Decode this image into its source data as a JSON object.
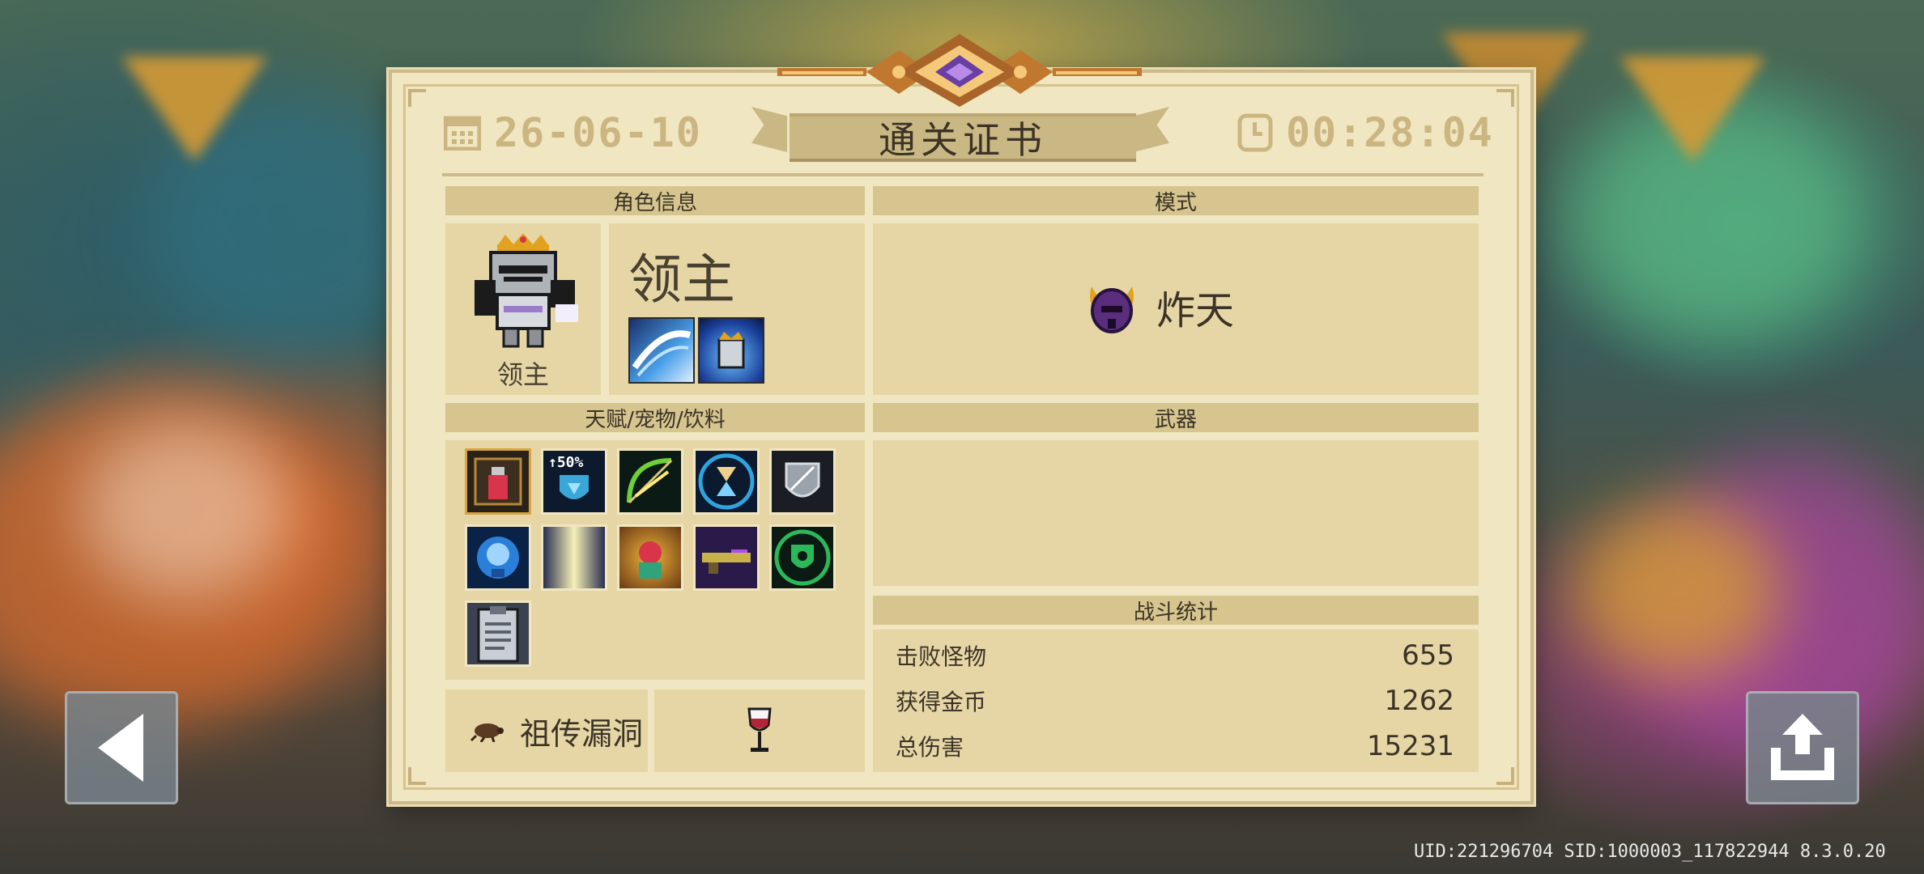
{
  "certificate": {
    "title": "通关证书",
    "date": "26-06-10",
    "time": "00:28:04",
    "icons": {
      "date": "calendar-icon",
      "time": "clock-icon"
    }
  },
  "character": {
    "section_label": "角色信息",
    "name": "领主",
    "portrait_caption": "领主",
    "skills": [
      "slash-skill-icon",
      "armor-skill-icon"
    ]
  },
  "mode": {
    "section_label": "模式",
    "name": "炸天",
    "icon": "demon-helmet-icon"
  },
  "talents": {
    "section_label": "天赋/宠物/饮料",
    "items": [
      {
        "icon": "potion-icon"
      },
      {
        "icon": "shield-heal-icon",
        "text": "↑50%"
      },
      {
        "icon": "bow-icon"
      },
      {
        "icon": "hourglass-icon"
      },
      {
        "icon": "armor-shield-icon"
      },
      {
        "icon": "mind-icon"
      },
      {
        "icon": "light-beam-icon"
      },
      {
        "icon": "hero-summon-icon"
      },
      {
        "icon": "laser-gun-icon"
      },
      {
        "icon": "green-shield-icon"
      },
      {
        "icon": "clipboard-icon"
      }
    ]
  },
  "weapon": {
    "section_label": "武器"
  },
  "stats": {
    "section_label": "战斗统计",
    "rows": [
      {
        "label": "击败怪物",
        "value": "655"
      },
      {
        "label": "获得金币",
        "value": "1262"
      },
      {
        "label": "总伤害",
        "value": "15231"
      }
    ]
  },
  "bug": {
    "label": "祖传漏洞",
    "icon": "bug-icon"
  },
  "drink": {
    "icon": "wine-glass-icon"
  },
  "footer": {
    "ids": "UID:221296704 SID:1000003_117822944 8.3.0.20"
  },
  "buttons": {
    "back": "back-arrow-icon",
    "share": "share-icon"
  }
}
